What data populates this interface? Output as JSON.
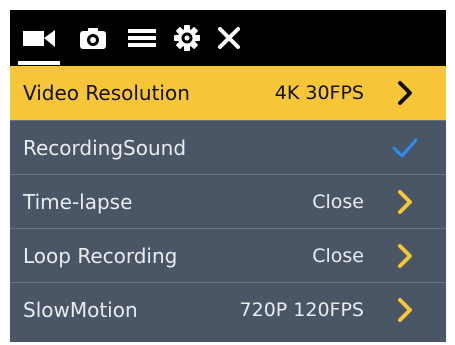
{
  "tabs": [
    {
      "icon": "video-camera-icon"
    },
    {
      "icon": "photo-camera-icon"
    },
    {
      "icon": "menu-icon"
    },
    {
      "icon": "gear-icon"
    },
    {
      "icon": "close-icon"
    }
  ],
  "colors": {
    "topbar": "#000000",
    "panel": "#4a5566",
    "selected": "#f7c638",
    "chevron": "#f7c638",
    "check": "#2f8ff0",
    "text": "#e9ecef"
  },
  "menu": {
    "items": [
      {
        "label": "Video Resolution",
        "value": "4K 30FPS",
        "icon": "chevron-right-icon",
        "selected": true
      },
      {
        "label": "RecordingSound",
        "value": "",
        "icon": "check-icon",
        "selected": false
      },
      {
        "label": "Time-lapse",
        "value": "Close",
        "icon": "chevron-right-icon",
        "selected": false
      },
      {
        "label": "Loop Recording",
        "value": "Close",
        "icon": "chevron-right-icon",
        "selected": false
      },
      {
        "label": "SlowMotion",
        "value": "720P 120FPS",
        "icon": "chevron-right-icon",
        "selected": false
      }
    ]
  }
}
